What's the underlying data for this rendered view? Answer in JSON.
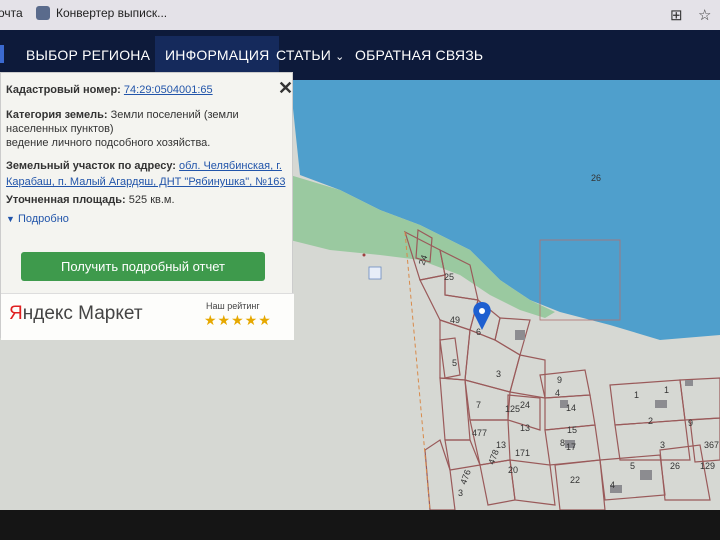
{
  "browser": {
    "tab1_label": "очта",
    "tab2_label": "Конвертер выписк..."
  },
  "nav": {
    "region": "ВЫБОР РЕГИОНА",
    "info": "ИНФОРМАЦИЯ",
    "articles": "СТАТЬИ",
    "feedback": "ОБРАТНАЯ СВЯЗЬ"
  },
  "popup": {
    "cadastral_label": "Кадастровый номер:",
    "cadastral_value": "74:29:0504001:65",
    "category_label": "Категория земель:",
    "category_value_1": "Земли поселений (земли",
    "category_value_2": "населенных пунктов)",
    "usage": "ведение личного подсобного хозяйства.",
    "address_label": "Земельный участок по адресу:",
    "address_part1": "обл. Челябинская, г.",
    "address_part2": "Карабаш, п. Малый Агардяш, ДНТ \"Рябинушка\", №163",
    "area_label": "Уточненная площадь:",
    "area_value": "525 кв.м.",
    "more": "Подробно",
    "report_button": "Получить подробный отчет"
  },
  "ad": {
    "logo_part1": "Я",
    "logo_part2": "ндекс Маркет",
    "rating_label": "Наш рейтинг",
    "stars": "★★★★★"
  },
  "map": {
    "labels": [
      "26",
      "24",
      "25",
      "49",
      "6",
      "3",
      "1",
      "5",
      "7",
      "125",
      "24",
      "13",
      "14",
      "15",
      "9",
      "4",
      "8",
      "477",
      "13",
      "17",
      "171",
      "20",
      "22",
      "478",
      "476",
      "3",
      "1",
      "2",
      "3",
      "9",
      "26",
      "129",
      "367",
      "5",
      "4",
      "3"
    ]
  },
  "colors": {
    "nav_bg": "#0d1a3a",
    "button_green": "#3e9a4c",
    "marker_blue": "#1e5fd0",
    "water": "#4a9fd1",
    "plot_line": "#9a5a5a"
  }
}
